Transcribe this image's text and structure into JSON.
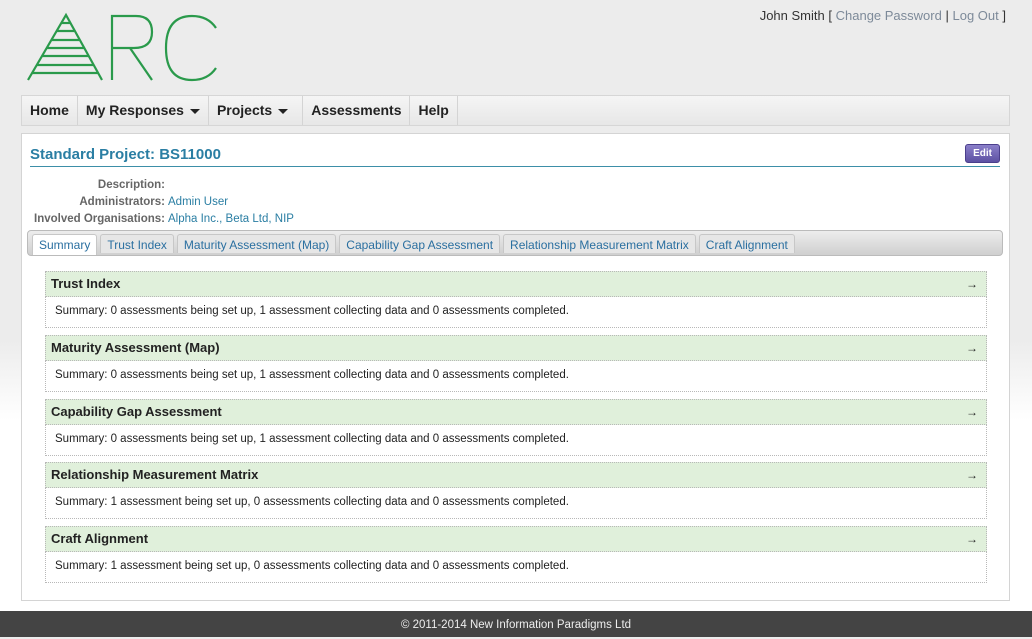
{
  "brand": {
    "logo_text": "ARC",
    "color": "#2a9a4b"
  },
  "user": {
    "name": "John Smith",
    "open_bracket": "[",
    "change_password": "Change Password",
    "separator": "|",
    "logout": "Log Out",
    "close_bracket": "]"
  },
  "nav": {
    "home": "Home",
    "my_responses": "My Responses",
    "projects": "Projects",
    "assessments": "Assessments",
    "help": "Help"
  },
  "project": {
    "title": "Standard Project: BS11000",
    "edit_label": "Edit",
    "description_label": "Description:",
    "description_value": "",
    "administrators_label": "Administrators:",
    "administrators_value": "Admin User",
    "organisations_label": "Involved Organisations:",
    "organisations_value": "Alpha Inc., Beta Ltd, NIP"
  },
  "tabs": [
    {
      "label": "Summary",
      "active": true
    },
    {
      "label": "Trust Index"
    },
    {
      "label": "Maturity Assessment (Map)"
    },
    {
      "label": "Capability Gap Assessment"
    },
    {
      "label": "Relationship Measurement Matrix"
    },
    {
      "label": "Craft Alignment"
    }
  ],
  "sections": [
    {
      "title": "Trust Index",
      "arrow": "→",
      "summary": "Summary: 0 assessments being set up, 1 assessment collecting data and 0 assessments completed."
    },
    {
      "title": "Maturity Assessment (Map)",
      "arrow": "→",
      "summary": "Summary: 0 assessments being set up, 1 assessment collecting data and 0 assessments completed."
    },
    {
      "title": "Capability Gap Assessment",
      "arrow": "→",
      "summary": "Summary: 0 assessments being set up, 1 assessment collecting data and 0 assessments completed."
    },
    {
      "title": "Relationship Measurement Matrix",
      "arrow": "→",
      "summary": "Summary: 1 assessment being set up, 0 assessments collecting data and 0 assessments completed."
    },
    {
      "title": "Craft Alignment",
      "arrow": "→",
      "summary": "Summary: 1 assessment being set up, 0 assessments collecting data and 0 assessments completed."
    }
  ],
  "footer": {
    "copyright": "© 2011-2014 New Information Paradigms Ltd"
  }
}
